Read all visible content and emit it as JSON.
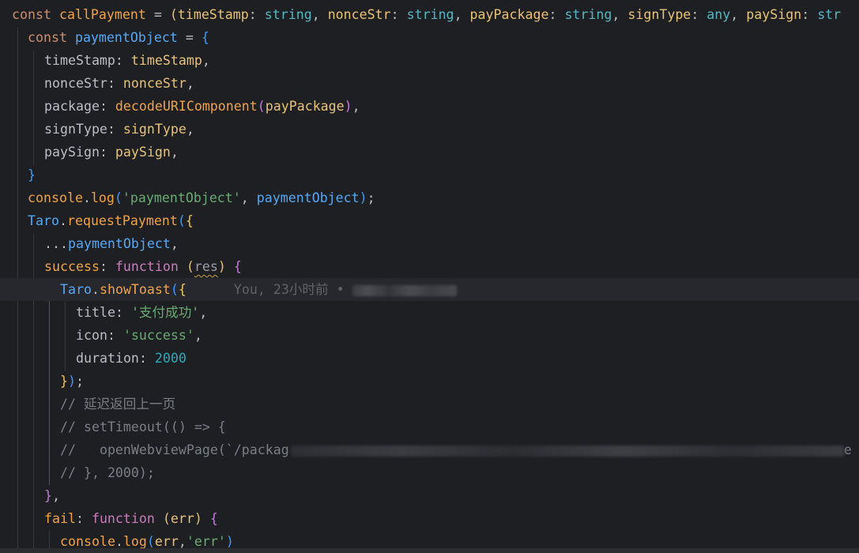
{
  "colors": {
    "background": "#1e1f22",
    "current_line": "#26282e",
    "keyword": "#cf8e6d",
    "string": "#6aab73",
    "number": "#2aacb8",
    "comment": "#7a7e85"
  },
  "code": {
    "l1": {
      "kw": "const",
      "name": "callPayment",
      "eq": " = ",
      "p1": "timeStamp",
      "p2": "nonceStr",
      "p3": "payPackage",
      "p4": "signType",
      "p5": "paySign",
      "t_string": "string",
      "t_any": "any",
      "t_trunc": "str"
    },
    "l2": {
      "kw": "const",
      "name": "paymentObject",
      "eq": " = "
    },
    "l3": {
      "key": "timeStamp",
      "val": "timeStamp"
    },
    "l4": {
      "key": "nonceStr",
      "val": "nonceStr"
    },
    "l5": {
      "key": "package",
      "fn": "decodeURIComponent",
      "arg": "payPackage"
    },
    "l6": {
      "key": "signType",
      "val": "signType"
    },
    "l7": {
      "key": "paySign",
      "val": "paySign"
    },
    "l9": {
      "obj": "console",
      "fn": "log",
      "str": "'paymentObject'",
      "arg": "paymentObject"
    },
    "l10": {
      "obj": "Taro",
      "fn": "requestPayment"
    },
    "l11": {
      "spread": "...",
      "arg": "paymentObject"
    },
    "l12": {
      "key": "success",
      "kw": "function",
      "param": "res"
    },
    "l13": {
      "obj": "Taro",
      "fn": "showToast",
      "blame": "You, 23小时前 •"
    },
    "l14": {
      "key": "title",
      "str": "'支付成功'"
    },
    "l15": {
      "key": "icon",
      "str": "'success'"
    },
    "l16": {
      "key": "duration",
      "num": "2000"
    },
    "l18": {
      "comment": "// 延迟返回上一页"
    },
    "l19": {
      "comment": "// setTimeout(() => {"
    },
    "l20": {
      "comment": "//   openWebviewPage(`/packag",
      "tail": "e"
    },
    "l21": {
      "comment": "// }, 2000);"
    },
    "l23": {
      "key": "fail",
      "kw": "function",
      "param": "err"
    },
    "l24": {
      "obj": "console",
      "fn": "log",
      "arg": "err",
      "str": "'err'"
    }
  }
}
